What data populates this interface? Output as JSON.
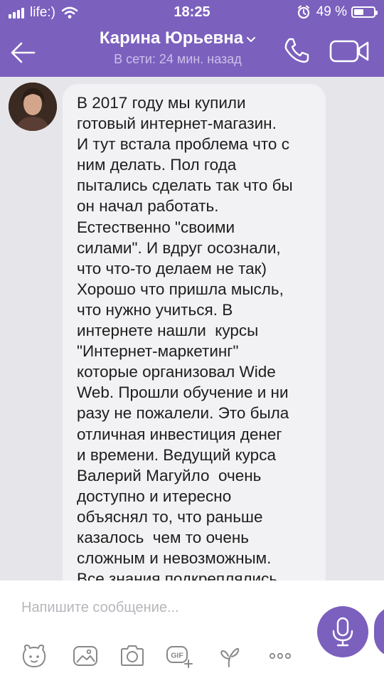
{
  "status_bar": {
    "carrier": "life:)",
    "time": "18:25",
    "battery_percent": "49 %",
    "battery_level": 0.49,
    "icons": [
      "signal-icon",
      "wifi-icon",
      "alarm-icon",
      "battery-icon"
    ]
  },
  "header": {
    "contact_name": "Карина Юрьевна",
    "status": "В сети: 24 мин. назад",
    "icons": [
      "back-arrow-icon",
      "chevron-down-icon",
      "phone-icon",
      "video-camera-icon"
    ]
  },
  "message": {
    "text": "В 2017 году мы купили\nготовый интернет-магазин.\nИ тут встала проблема что с\nним делать. Пол года\nпытались сделать так что бы\nон начал работать.\nЕстественно \"своими\nсилами\". И вдруг осознали,\nчто что-то делаем не так)\nХорошо что пришла мысль,\nчто нужно учиться. В\nинтернете нашли  курсы\n\"Интернет-маркетинг\"\nкоторые организовал Wide\nWeb. Прошли обучение и ни\nразу не пожалели. Это была\nотличная инвестиция денег\nи времени. Ведущий курса\nВалерий Магуйло  очень\nдоступно и итересно\nобъяснял то, что раньше\nказалось  чем то очень\nсложным и невозможным.\nВсе знания подкреплялись"
  },
  "composer": {
    "placeholder": "Напишите сообщение...",
    "toolbar_icons": [
      "sticker-icon",
      "image-icon",
      "camera-icon",
      "gif-add-icon",
      "doodle-icon",
      "more-icon"
    ],
    "send_icon": "microphone-icon"
  },
  "colors": {
    "brand": "#7b60be",
    "chat_background": "#e6e6ea",
    "bubble": "#f2f2f4"
  }
}
